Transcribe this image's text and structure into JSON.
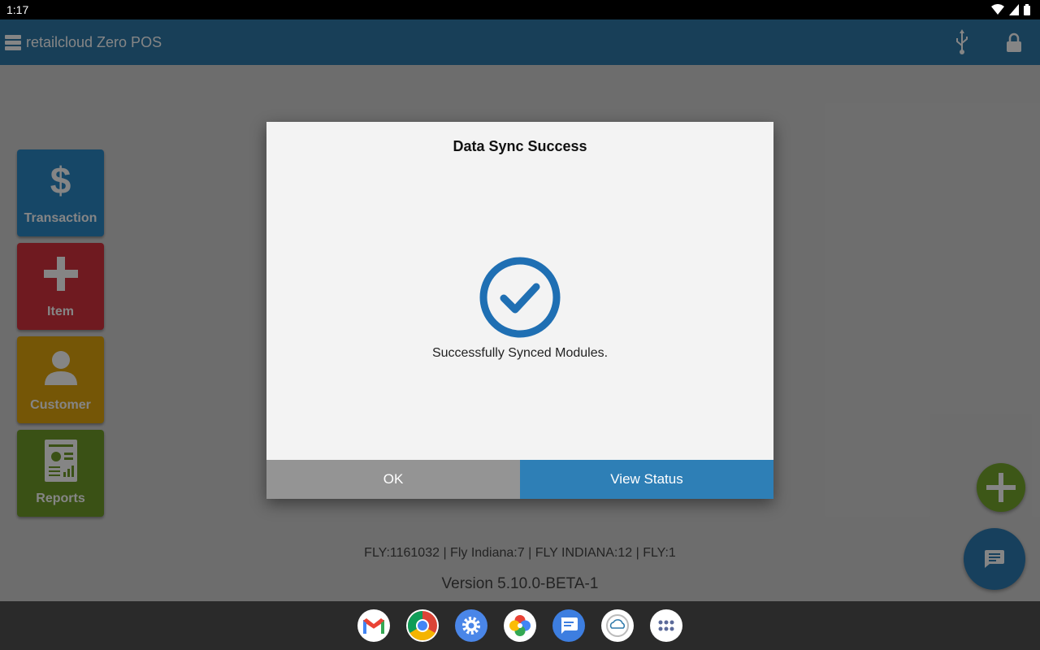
{
  "status_bar": {
    "time": "1:17"
  },
  "app_bar": {
    "title": "retailcloud Zero POS"
  },
  "tiles": [
    {
      "label": "Transaction",
      "icon": "dollar-icon"
    },
    {
      "label": "Item",
      "icon": "plus-icon"
    },
    {
      "label": "Customer",
      "icon": "person-icon"
    },
    {
      "label": "Reports",
      "icon": "report-icon"
    }
  ],
  "footer": {
    "info": "FLY:1161032 | Fly Indiana:7 | FLY INDIANA:12 | FLY:1",
    "version": "Version 5.10.0-BETA-1"
  },
  "dialog": {
    "title": "Data Sync Success",
    "message": "Successfully Synced Modules.",
    "ok_label": "OK",
    "view_status_label": "View Status",
    "icon": "check-circle-icon"
  },
  "dock": [
    "gmail-icon",
    "chrome-icon",
    "settings-icon",
    "photos-icon",
    "messages-icon",
    "retailcloud-icon",
    "apps-icon"
  ],
  "colors": {
    "app_bar": "#2e79aa",
    "transaction": "#2b88c6",
    "item": "#d5333f",
    "customer": "#e1a50c",
    "reports": "#6f9b2a",
    "ok_button": "#949494",
    "view_status_button": "#2e7fb6",
    "check": "#1f6fb3"
  }
}
